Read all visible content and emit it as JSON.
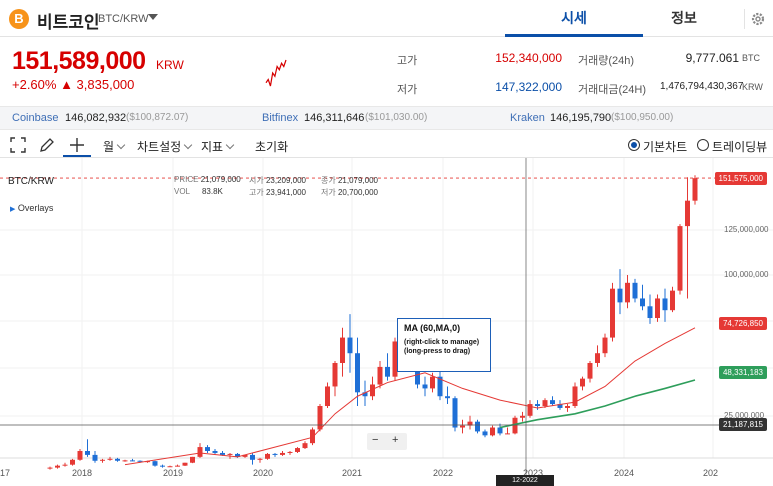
{
  "header": {
    "coin_icon_glyph": "B",
    "coin_name": "비트코인",
    "pair": "BTC/KRW",
    "tabs": [
      {
        "label": "시세",
        "active": true
      },
      {
        "label": "정보",
        "active": false
      }
    ]
  },
  "price": {
    "current": "151,589,000",
    "unit": "KRW",
    "change_pct": "+2.60%",
    "change_amt": "▲ 3,835,000"
  },
  "stats": {
    "high_label": "고가",
    "high_value": "152,340,000",
    "low_label": "저가",
    "low_value": "147,322,000",
    "volume_label": "거래량(24h)",
    "volume_value": "9,777.061",
    "volume_unit": "BTC",
    "turnover_label": "거래대금(24H)",
    "turnover_value": "1,476,794,430,367",
    "turnover_unit": "KRW"
  },
  "exchanges": [
    {
      "name": "Coinbase",
      "krw": "146,082,932",
      "usd": "($100,872.07)"
    },
    {
      "name": "Bitfinex",
      "krw": "146,311,646",
      "usd": "($101,030.00)"
    },
    {
      "name": "Kraken",
      "krw": "146,195,790",
      "usd": "($100,950.00)"
    }
  ],
  "toolbar": {
    "period": "월",
    "chart_settings": "차트설정",
    "indicators": "지표",
    "reset": "초기화",
    "basic_chart": "기본차트",
    "tradingview": "트레이딩뷰"
  },
  "chart": {
    "symbol": "BTC/KRW",
    "overlays_label": "Overlays",
    "ohlc": {
      "price_k": "PRICE",
      "price_v": "21,079,000",
      "open_k": "시가",
      "open_v": "23,209,000",
      "close_k": "종가",
      "close_v": "21,079,000",
      "vol_k": "VOL",
      "vol_v": "83.8K",
      "high_k": "고가",
      "high_v": "23,941,000",
      "low_k": "저가",
      "low_v": "20,700,000"
    },
    "tooltip": {
      "title": "MA (60,MA,0)",
      "line1": "(right-click to manage)",
      "line2": "(long-press to drag)"
    },
    "zoom_minus": "−",
    "zoom_plus": "+",
    "price_labels": [
      {
        "value": "151,575,000",
        "color": "#e53935"
      },
      {
        "value": "74,726,850",
        "color": "#e53935"
      },
      {
        "value": "48,331,183",
        "color": "#2e9e5b"
      },
      {
        "value": "21,187,815",
        "color": "#333333"
      }
    ],
    "y_ticks": [
      "125,000,000",
      "100,000,000",
      "25,000,000"
    ],
    "x_ticks": [
      "17",
      "2018",
      "2019",
      "2020",
      "2021",
      "2022",
      "2023",
      "2024",
      "202"
    ],
    "crosshair_date": "12-2022",
    "colors": {
      "up": "#e53935",
      "down": "#1e6fd6",
      "ma_short": "#e53935",
      "ma_long": "#2e9e5b"
    },
    "candles": [
      {
        "o": 3,
        "h": 4,
        "l": 2.5,
        "c": 3.5
      },
      {
        "o": 3.5,
        "h": 5,
        "l": 3,
        "c": 4.5
      },
      {
        "o": 4.5,
        "h": 6,
        "l": 4,
        "c": 5
      },
      {
        "o": 5,
        "h": 8,
        "l": 4.5,
        "c": 7.5
      },
      {
        "o": 7.5,
        "h": 13,
        "l": 7,
        "c": 12
      },
      {
        "o": 12,
        "h": 18,
        "l": 9,
        "c": 10
      },
      {
        "o": 10,
        "h": 12,
        "l": 6,
        "c": 7
      },
      {
        "o": 7,
        "h": 8,
        "l": 6,
        "c": 7.5
      },
      {
        "o": 7.5,
        "h": 9,
        "l": 7,
        "c": 8
      },
      {
        "o": 8,
        "h": 8.5,
        "l": 6.5,
        "c": 7
      },
      {
        "o": 7,
        "h": 7.5,
        "l": 6.5,
        "c": 7.2
      },
      {
        "o": 7.2,
        "h": 8,
        "l": 6.8,
        "c": 7
      },
      {
        "o": 7,
        "h": 7.2,
        "l": 6,
        "c": 6.5
      },
      {
        "o": 6.5,
        "h": 7,
        "l": 6,
        "c": 6.8
      },
      {
        "o": 6.8,
        "h": 7,
        "l": 4,
        "c": 4.5
      },
      {
        "o": 4.5,
        "h": 5,
        "l": 3.5,
        "c": 4
      },
      {
        "o": 4,
        "h": 4.5,
        "l": 3.8,
        "c": 4.2
      },
      {
        "o": 4.2,
        "h": 5,
        "l": 4,
        "c": 4.5
      },
      {
        "o": 4.5,
        "h": 6,
        "l": 4.3,
        "c": 6
      },
      {
        "o": 6,
        "h": 9,
        "l": 5.8,
        "c": 9
      },
      {
        "o": 9,
        "h": 16,
        "l": 8.5,
        "c": 14
      },
      {
        "o": 14,
        "h": 15,
        "l": 11,
        "c": 12
      },
      {
        "o": 12,
        "h": 13,
        "l": 10,
        "c": 11
      },
      {
        "o": 11,
        "h": 12,
        "l": 9.5,
        "c": 10
      },
      {
        "o": 10,
        "h": 11,
        "l": 8,
        "c": 10.5
      },
      {
        "o": 10.5,
        "h": 11,
        "l": 8.5,
        "c": 9
      },
      {
        "o": 9,
        "h": 10,
        "l": 8.5,
        "c": 10
      },
      {
        "o": 10,
        "h": 11,
        "l": 5,
        "c": 7.5
      },
      {
        "o": 7.5,
        "h": 8.5,
        "l": 6,
        "c": 8
      },
      {
        "o": 8,
        "h": 11,
        "l": 7.5,
        "c": 10.5
      },
      {
        "o": 10.5,
        "h": 11,
        "l": 9,
        "c": 10
      },
      {
        "o": 10,
        "h": 12,
        "l": 9.5,
        "c": 11
      },
      {
        "o": 11,
        "h": 12,
        "l": 10,
        "c": 11.5
      },
      {
        "o": 11.5,
        "h": 14,
        "l": 11,
        "c": 13.5
      },
      {
        "o": 13.5,
        "h": 17,
        "l": 13,
        "c": 16
      },
      {
        "o": 16,
        "h": 24,
        "l": 15,
        "c": 23
      },
      {
        "o": 23,
        "h": 36,
        "l": 22,
        "c": 35
      },
      {
        "o": 35,
        "h": 47,
        "l": 34,
        "c": 45
      },
      {
        "o": 45,
        "h": 58,
        "l": 40,
        "c": 57
      },
      {
        "o": 57,
        "h": 75,
        "l": 50,
        "c": 70
      },
      {
        "o": 70,
        "h": 82,
        "l": 52,
        "c": 62
      },
      {
        "o": 62,
        "h": 70,
        "l": 35,
        "c": 42
      },
      {
        "o": 42,
        "h": 48,
        "l": 35,
        "c": 40
      },
      {
        "o": 40,
        "h": 50,
        "l": 38,
        "c": 46
      },
      {
        "o": 46,
        "h": 58,
        "l": 44,
        "c": 55
      },
      {
        "o": 55,
        "h": 62,
        "l": 48,
        "c": 50
      },
      {
        "o": 50,
        "h": 70,
        "l": 48,
        "c": 68
      },
      {
        "o": 68,
        "h": 78,
        "l": 62,
        "c": 70
      },
      {
        "o": 70,
        "h": 75,
        "l": 55,
        "c": 58
      },
      {
        "o": 58,
        "h": 62,
        "l": 44,
        "c": 46
      },
      {
        "o": 46,
        "h": 50,
        "l": 40,
        "c": 44
      },
      {
        "o": 44,
        "h": 52,
        "l": 42,
        "c": 50
      },
      {
        "o": 50,
        "h": 55,
        "l": 38,
        "c": 40
      },
      {
        "o": 40,
        "h": 45,
        "l": 36,
        "c": 39
      },
      {
        "o": 39,
        "h": 40,
        "l": 22,
        "c": 24
      },
      {
        "o": 24,
        "h": 28,
        "l": 21,
        "c": 25
      },
      {
        "o": 25,
        "h": 30,
        "l": 23,
        "c": 27
      },
      {
        "o": 27,
        "h": 28,
        "l": 21,
        "c": 22
      },
      {
        "o": 22,
        "h": 23,
        "l": 19,
        "c": 20
      },
      {
        "o": 20,
        "h": 25,
        "l": 19.5,
        "c": 24
      },
      {
        "o": 24,
        "h": 26,
        "l": 20,
        "c": 21
      },
      {
        "o": 21,
        "h": 24,
        "l": 20.7,
        "c": 21
      },
      {
        "o": 21,
        "h": 30,
        "l": 20.5,
        "c": 29
      },
      {
        "o": 29,
        "h": 32,
        "l": 27,
        "c": 30
      },
      {
        "o": 30,
        "h": 38,
        "l": 29,
        "c": 36
      },
      {
        "o": 36,
        "h": 38,
        "l": 33,
        "c": 35
      },
      {
        "o": 35,
        "h": 39,
        "l": 34,
        "c": 38
      },
      {
        "o": 38,
        "h": 40,
        "l": 35,
        "c": 36
      },
      {
        "o": 36,
        "h": 38,
        "l": 33,
        "c": 34
      },
      {
        "o": 34,
        "h": 36,
        "l": 32,
        "c": 35
      },
      {
        "o": 35,
        "h": 47,
        "l": 34,
        "c": 45
      },
      {
        "o": 45,
        "h": 50,
        "l": 43,
        "c": 49
      },
      {
        "o": 49,
        "h": 58,
        "l": 47,
        "c": 57
      },
      {
        "o": 57,
        "h": 66,
        "l": 55,
        "c": 62
      },
      {
        "o": 62,
        "h": 72,
        "l": 60,
        "c": 70
      },
      {
        "o": 70,
        "h": 98,
        "l": 68,
        "c": 95
      },
      {
        "o": 95,
        "h": 105,
        "l": 82,
        "c": 88
      },
      {
        "o": 88,
        "h": 102,
        "l": 85,
        "c": 98
      },
      {
        "o": 98,
        "h": 100,
        "l": 88,
        "c": 90
      },
      {
        "o": 90,
        "h": 97,
        "l": 84,
        "c": 86
      },
      {
        "o": 86,
        "h": 92,
        "l": 77,
        "c": 80
      },
      {
        "o": 80,
        "h": 92,
        "l": 78,
        "c": 90
      },
      {
        "o": 90,
        "h": 95,
        "l": 78,
        "c": 84
      },
      {
        "o": 84,
        "h": 96,
        "l": 83,
        "c": 94
      },
      {
        "o": 94,
        "h": 128,
        "l": 92,
        "c": 127
      },
      {
        "o": 127,
        "h": 152,
        "l": 90,
        "c": 140
      },
      {
        "o": 140,
        "h": 153,
        "l": 138,
        "c": 151.5
      }
    ],
    "ma_short": [
      [
        10,
        5
      ],
      [
        20,
        11
      ],
      [
        25,
        9
      ],
      [
        35,
        19
      ],
      [
        38,
        31
      ],
      [
        41,
        40
      ],
      [
        45,
        47
      ],
      [
        50,
        52
      ],
      [
        55,
        44
      ],
      [
        60,
        38
      ],
      [
        65,
        34
      ],
      [
        70,
        37
      ],
      [
        74,
        45
      ],
      [
        78,
        58
      ],
      [
        82,
        67
      ],
      [
        86,
        75
      ]
    ],
    "ma_long": [
      [
        60,
        24
      ],
      [
        65,
        28
      ],
      [
        70,
        31
      ],
      [
        74,
        35
      ],
      [
        78,
        40
      ],
      [
        82,
        44
      ],
      [
        86,
        48.3
      ]
    ],
    "mini_chart": [
      3,
      4,
      2,
      6,
      5,
      8,
      7,
      9,
      8,
      10
    ]
  }
}
